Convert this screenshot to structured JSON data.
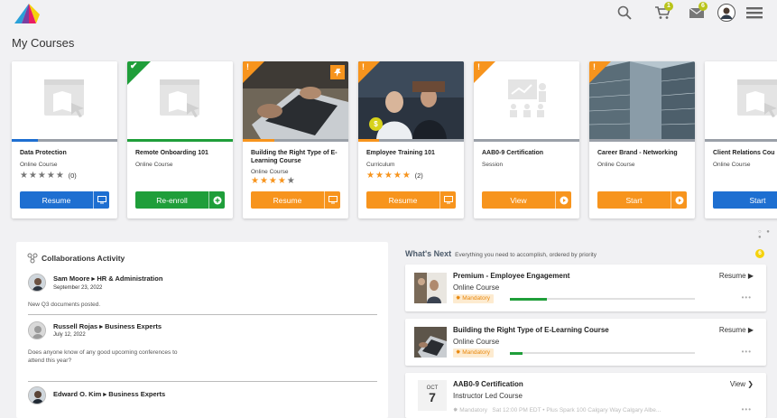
{
  "header": {
    "cart_badge": "1",
    "mail_badge": "6"
  },
  "page_title": "My Courses",
  "courses": [
    {
      "title": "Data Protection",
      "type": "Online Course",
      "rating_count": "(0)",
      "action": "Resume",
      "color": "#1e6fd1",
      "progress": 0.25
    },
    {
      "title": "Remote Onboarding 101",
      "type": "Online Course",
      "action": "Re-enroll",
      "color": "#1f9e3a",
      "progress": 1.0
    },
    {
      "title": "Building the Right Type of E-Learning Course",
      "type": "Online Course",
      "action": "Resume",
      "color": "#f7941d",
      "progress": 0.3
    },
    {
      "title": "Employee Training 101",
      "type": "Curriculum",
      "rating_count": "(2)",
      "action": "Resume",
      "color": "#f7941d",
      "progress": 0.2,
      "thumb_badge": "$"
    },
    {
      "title": "AAB0-9 Certification",
      "type": "Session",
      "action": "View",
      "color": "#f7941d",
      "progress": 0.0
    },
    {
      "title": "Career Brand - Networking",
      "type": "Online Course",
      "action": "Start",
      "color": "#f7941d",
      "progress": 0.0
    },
    {
      "title": "Client Relations Cou",
      "type": "Online Course",
      "action": "Start",
      "color": "#1e6fd1",
      "progress": 0.0
    }
  ],
  "collaborations": {
    "title": "Collaborations Activity",
    "posts": [
      {
        "author": "Sam Moore ▸ HR & Administration",
        "date": "September 23, 2022",
        "body": "New Q3 documents posted."
      },
      {
        "author": "Russell Rojas ▸ Business Experts",
        "date": "July 12, 2022",
        "body": "Does anyone know of any good upcoming conferences to attend this year?"
      },
      {
        "author": "Edward O. Kim ▸ Business Experts"
      }
    ]
  },
  "whats_next": {
    "title": "What's Next",
    "description": "Everything you need to accomplish, ordered by priority",
    "count": "6",
    "items": [
      {
        "title": "Premium - Employee Engagement",
        "type": "Online Course",
        "tag": "Mandatory",
        "action": "Resume ▶",
        "progress": 0.2
      },
      {
        "title": "Building the Right Type of E-Learning Course",
        "type": "Online Course",
        "tag": "Mandatory",
        "action": "Resume ▶",
        "progress": 0.07
      },
      {
        "title": "AAB0-9 Certification",
        "type": "Instructor Led Course",
        "tag": "Mandatory",
        "action": "View ❯",
        "month": "OCT",
        "day": "7",
        "session": "Sat 12:00 PM EDT  •  Plus Spark 100 Calgary Way Calgary Albe..."
      }
    ]
  }
}
